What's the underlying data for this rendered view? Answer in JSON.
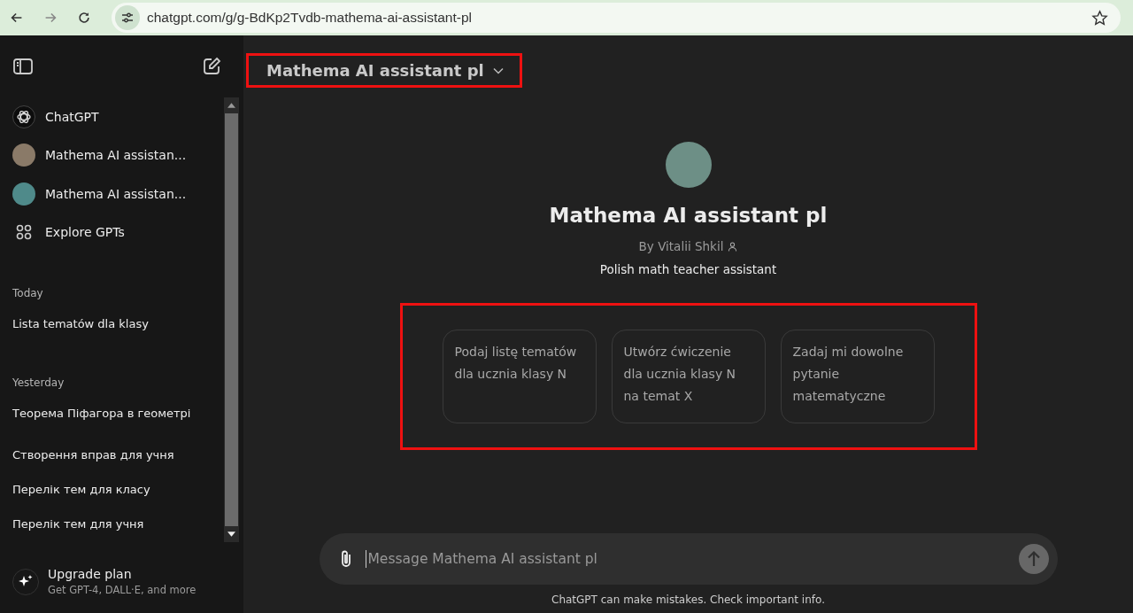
{
  "browser": {
    "url": "chatgpt.com/g/g-BdKp2Tvdb-mathema-ai-assistant-pl"
  },
  "sidebar": {
    "gpts": [
      {
        "kind": "logo",
        "label": "ChatGPT"
      },
      {
        "kind": "avatar",
        "label": "Mathema AI assistan...",
        "color": "#8a7a68"
      },
      {
        "kind": "avatar",
        "label": "Mathema AI assistan...",
        "color": "#4f8a8a"
      },
      {
        "kind": "explore",
        "label": "Explore GPTs"
      }
    ],
    "sections": [
      {
        "label": "Today",
        "chats": [
          "Lista tematów dla klasy"
        ]
      },
      {
        "label": "Yesterday",
        "chats": [
          "Теорема Піфагора в геометрі",
          "Створення вправ для учня",
          "Перелік тем для класу",
          "Перелік тем для учня"
        ]
      }
    ],
    "upgrade": {
      "title": "Upgrade plan",
      "subtitle": "Get GPT-4, DALL·E, and more"
    }
  },
  "header": {
    "title": "Mathema AI assistant pl"
  },
  "profile": {
    "name": "Mathema AI assistant pl",
    "author": "By Vitalii Shkil",
    "description": "Polish math teacher assistant"
  },
  "suggestions": [
    "Podaj listę tematów dla ucznia klasy N",
    "Utwórz ćwiczenie dla ucznia klasy N na temat X",
    "Zadaj mi dowolne pytanie matematyczne"
  ],
  "composer": {
    "placeholder": "Message Mathema AI assistant pl"
  },
  "disclaimer": "ChatGPT can make mistakes. Check important info."
}
